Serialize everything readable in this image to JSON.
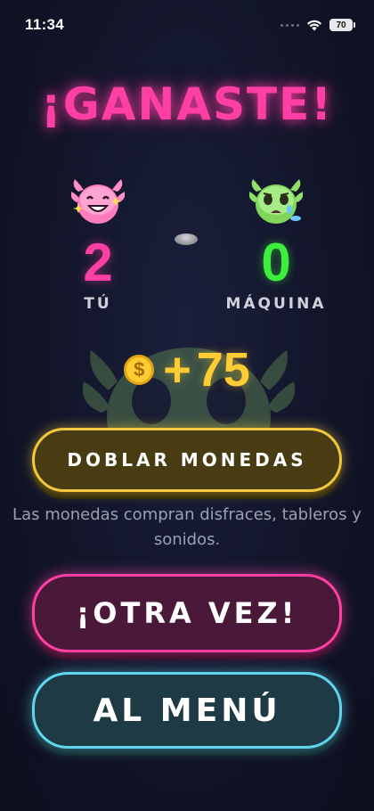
{
  "status_bar": {
    "time": "11:34",
    "battery": "70"
  },
  "title": "¡GANASTE!",
  "players": {
    "you": {
      "score": "2",
      "label": "TÚ",
      "avatar": "happy-axolotl-icon",
      "color": "#ff3fa4"
    },
    "cpu": {
      "score": "0",
      "label": "MÁQUINA",
      "avatar": "sad-green-axolotl-icon",
      "color": "#3dee3d"
    }
  },
  "reward": {
    "coin_symbol": "$",
    "plus": "+",
    "amount": "75",
    "color": "#ffcc33"
  },
  "buttons": {
    "double_coins": "DOBLAR MONEDAS",
    "play_again": "¡OTRA VEZ!",
    "to_menu": "AL MENÚ"
  },
  "hint": "Las monedas compran disfraces, tableros y sonidos.",
  "colors": {
    "accent_pink": "#ff3fa4",
    "accent_gold": "#f2c83a",
    "accent_cyan": "#5fd6ee"
  }
}
